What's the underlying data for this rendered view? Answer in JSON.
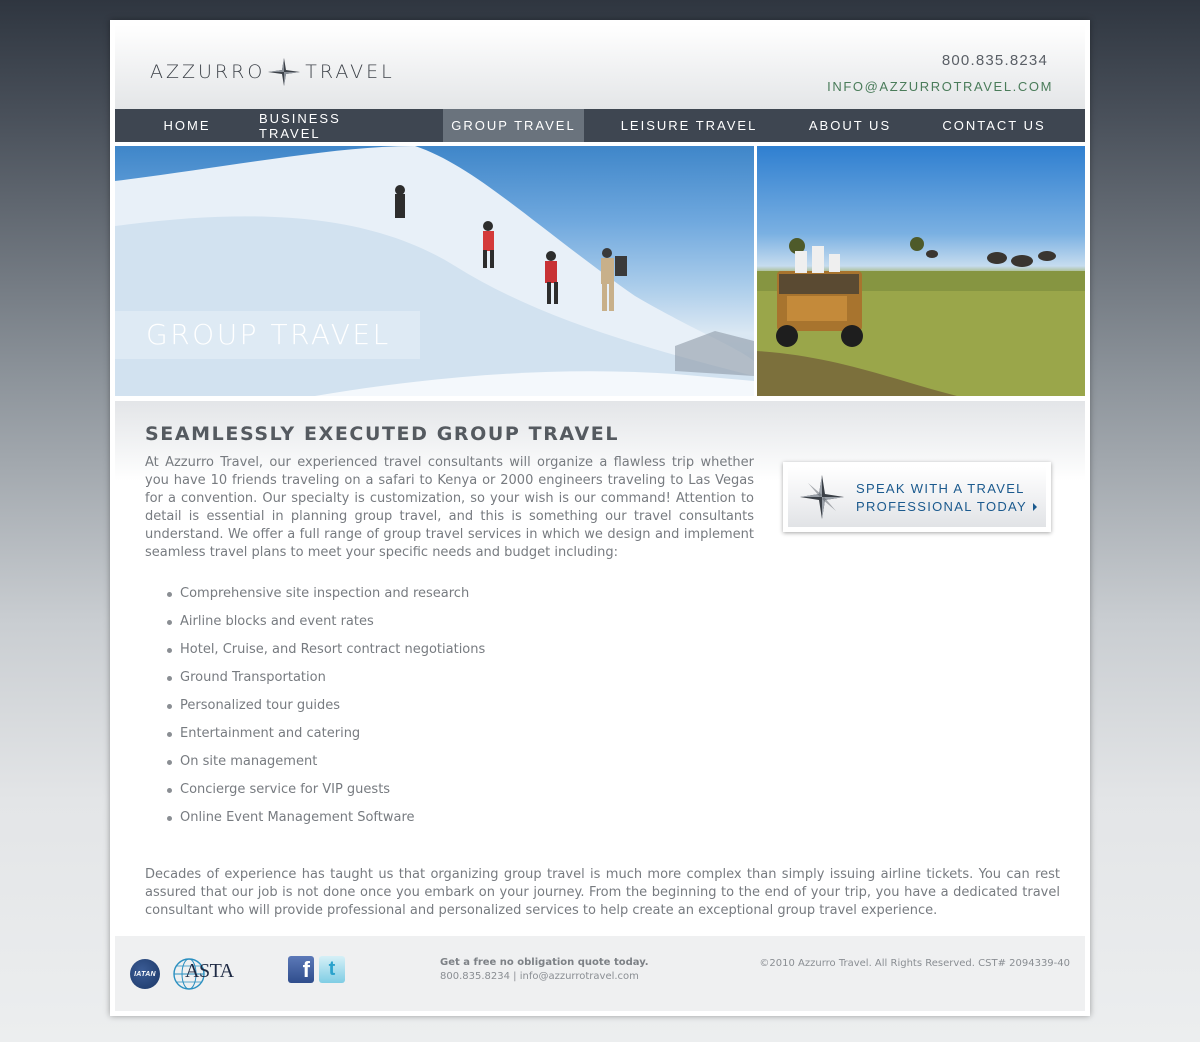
{
  "header": {
    "logo_left": "AZZURRO",
    "logo_right": "TRAVEL",
    "phone": "800.835.8234",
    "email": "INFO@AZZURROTRAVEL.COM"
  },
  "nav": {
    "items": [
      {
        "label": "HOME"
      },
      {
        "label": "BUSINESS TRAVEL"
      },
      {
        "label": "GROUP TRAVEL",
        "active": true
      },
      {
        "label": "LEISURE TRAVEL"
      },
      {
        "label": "ABOUT US"
      },
      {
        "label": "CONTACT US"
      }
    ]
  },
  "hero": {
    "label": "GROUP TRAVEL"
  },
  "content": {
    "title": "SEAMLESSLY EXECUTED GROUP TRAVEL",
    "intro": "At Azzurro Travel, our experienced travel consultants will organize a flawless trip whether you have 10 friends traveling on a safari to Kenya or 2000 engineers traveling to Las Vegas for a convention. Our specialty is customization, so your wish is our command! Attention to detail is essential in planning group travel, and this is something our travel consultants understand. We offer a full range of group travel services in which we design and implement seamless travel plans to meet your specific needs and budget including:",
    "services": [
      "Comprehensive site inspection and research",
      "Airline blocks and event rates",
      "Hotel, Cruise, and Resort contract negotiations",
      "Ground Transportation",
      "Personalized tour guides",
      "Entertainment and catering",
      "On site management",
      "Concierge service for VIP guests",
      "Online Event Management Software"
    ],
    "outro": "Decades of experience has taught us that organizing group travel is much more complex than simply issuing airline tickets. You can rest assured that our job is not done once you embark on your journey. From the beginning to the end of your trip, you have a dedicated travel consultant who will provide professional and personalized services to help create an exceptional group travel experience."
  },
  "cta": {
    "line1": "SPEAK WITH A TRAVEL",
    "line2": "PROFESSIONAL TODAY"
  },
  "footer": {
    "iatan": "IATAN",
    "asta": "ASTA",
    "facebook": "f",
    "twitter": "t",
    "quote_title": "Get a free no obligation quote today.",
    "quote_contact": "800.835.8234 | info@azzurrotravel.com",
    "copyright": "©2010 Azzurro Travel. All Rights Reserved. CST# 2094339-40"
  },
  "colors": {
    "nav_bg": "#3e4651",
    "nav_active": "#6a737d",
    "cta_text": "#1b5a8e",
    "email": "#4a7c5a"
  }
}
